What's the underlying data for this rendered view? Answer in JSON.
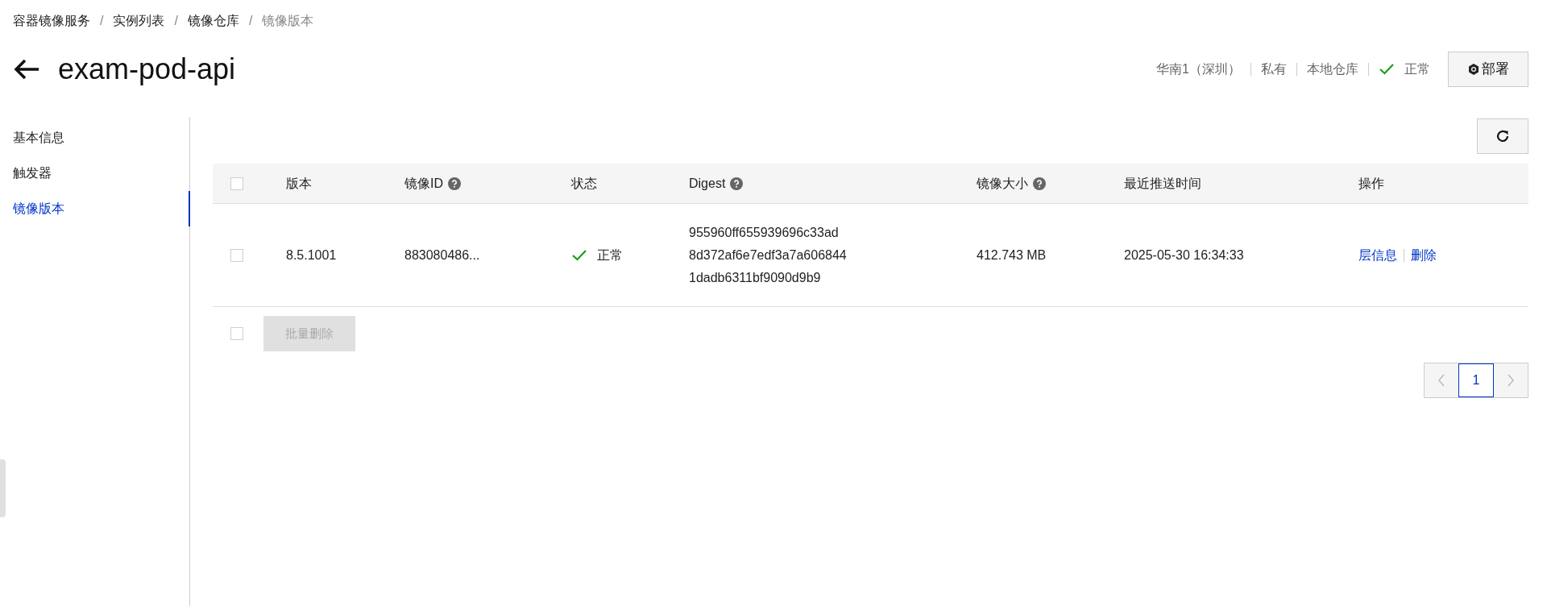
{
  "breadcrumb": {
    "separator": "/",
    "items": [
      "容器镜像服务",
      "实例列表",
      "镜像仓库",
      "镜像版本"
    ]
  },
  "title": "exam-pod-api",
  "meta": {
    "region": "华南1（深圳）",
    "visibility": "私有",
    "repo_type": "本地仓库",
    "status": "正常",
    "deploy_button": "部署"
  },
  "sidebar": {
    "items": [
      {
        "label": "基本信息",
        "selected": false
      },
      {
        "label": "触发器",
        "selected": false
      },
      {
        "label": "镜像版本",
        "selected": true
      }
    ]
  },
  "table": {
    "columns": [
      {
        "label": "版本",
        "help": false
      },
      {
        "label": "镜像ID",
        "help": true
      },
      {
        "label": "状态",
        "help": false
      },
      {
        "label": "Digest",
        "help": true
      },
      {
        "label": "镜像大小",
        "help": true
      },
      {
        "label": "最近推送时间",
        "help": false
      },
      {
        "label": "操作",
        "help": false
      }
    ],
    "header_checked": false,
    "rows": [
      {
        "checked": false,
        "version": "8.5.1001",
        "image_id": "883080486...",
        "status": "正常",
        "digest": [
          "955960ff655939696c33ad",
          "8d372af6e7edf3a7a606844",
          "1dadb6311bf9090d9b9"
        ],
        "size": "412.743 MB",
        "pushed": "2025-05-30 16:34:33",
        "actions": [
          "层信息",
          "删除"
        ]
      }
    ]
  },
  "footer": {
    "checked": false,
    "batch_delete": {
      "label": "批量删除",
      "disabled": true
    }
  },
  "pagination": {
    "pages": [
      {
        "label": "1",
        "selected": true
      }
    ]
  }
}
